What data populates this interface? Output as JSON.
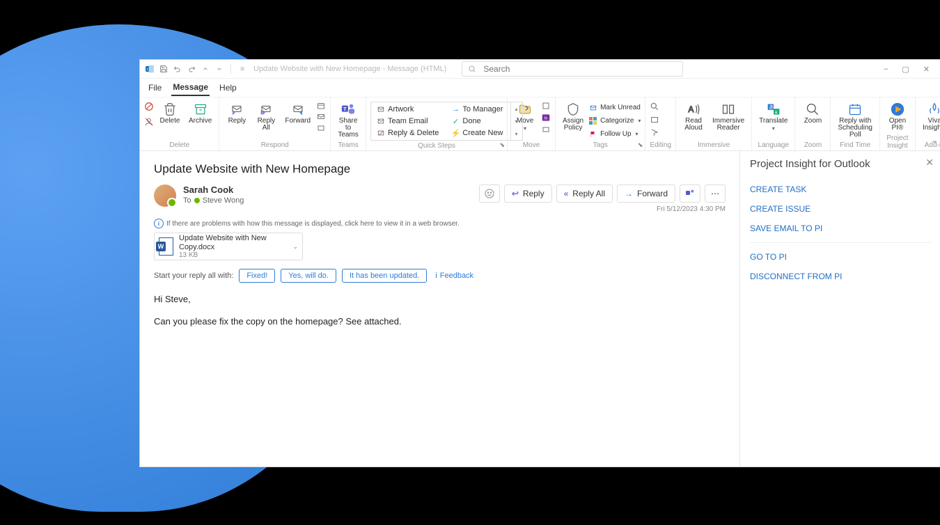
{
  "titlebar": {
    "title": "Update Website with New Homepage  -  Message (HTML)",
    "search_placeholder": "Search"
  },
  "menu": {
    "file": "File",
    "message": "Message",
    "help": "Help"
  },
  "ribbon": {
    "delete": {
      "delete": "Delete",
      "archive": "Archive",
      "group": "Delete"
    },
    "respond": {
      "reply": "Reply",
      "reply_all": "Reply\nAll",
      "forward": "Forward",
      "group": "Respond"
    },
    "teams": {
      "share": "Share to\nTeams",
      "group": "Teams"
    },
    "quick_steps": {
      "artwork": "Artwork",
      "team_email": "Team Email",
      "reply_delete": "Reply & Delete",
      "to_manager": "To Manager",
      "done": "Done",
      "create_new": "Create New",
      "group": "Quick Steps"
    },
    "move": {
      "move": "Move",
      "group": "Move"
    },
    "tags": {
      "assign": "Assign\nPolicy",
      "unread": "Mark Unread",
      "categorize": "Categorize",
      "follow_up": "Follow Up",
      "group": "Tags"
    },
    "editing": {
      "group": "Editing"
    },
    "immersive": {
      "read_aloud": "Read\nAloud",
      "immersive_reader": "Immersive\nReader",
      "group": "Immersive"
    },
    "language": {
      "translate": "Translate",
      "group": "Language"
    },
    "zoom": {
      "zoom": "Zoom",
      "group": "Zoom"
    },
    "findtime": {
      "schedule": "Reply with\nScheduling Poll",
      "group": "Find Time"
    },
    "pi": {
      "open": "Open\nPI®",
      "group": "Project Insight"
    },
    "addin": {
      "viva": "Viva\nInsights",
      "group": "Add-in"
    }
  },
  "message": {
    "subject": "Update Website with New Homepage",
    "sender": "Sarah Cook",
    "to_label": "To",
    "recipient": "Steve Wong",
    "date": "Fri 5/12/2023 4:30 PM",
    "info": "If there are problems with how this message is displayed, click here to view it in a web browser.",
    "actions": {
      "reply": "Reply",
      "reply_all": "Reply All",
      "forward": "Forward"
    },
    "attachment": {
      "name": "Update Website with New Copy.docx",
      "size": "13 KB"
    },
    "suggest_label": "Start your reply all with:",
    "suggestions": {
      "s1": "Fixed!",
      "s2": "Yes, will do.",
      "s3": "It has been updated."
    },
    "feedback": "Feedback",
    "body_line1": "Hi Steve,",
    "body_line2": "Can you please fix the copy on the homepage? See attached."
  },
  "panel": {
    "title": "Project Insight for Outlook",
    "create_task": "CREATE TASK",
    "create_issue": "CREATE ISSUE",
    "save_email": "SAVE EMAIL TO PI",
    "go_to_pi": "GO TO PI",
    "disconnect": "DISCONNECT FROM PI"
  }
}
